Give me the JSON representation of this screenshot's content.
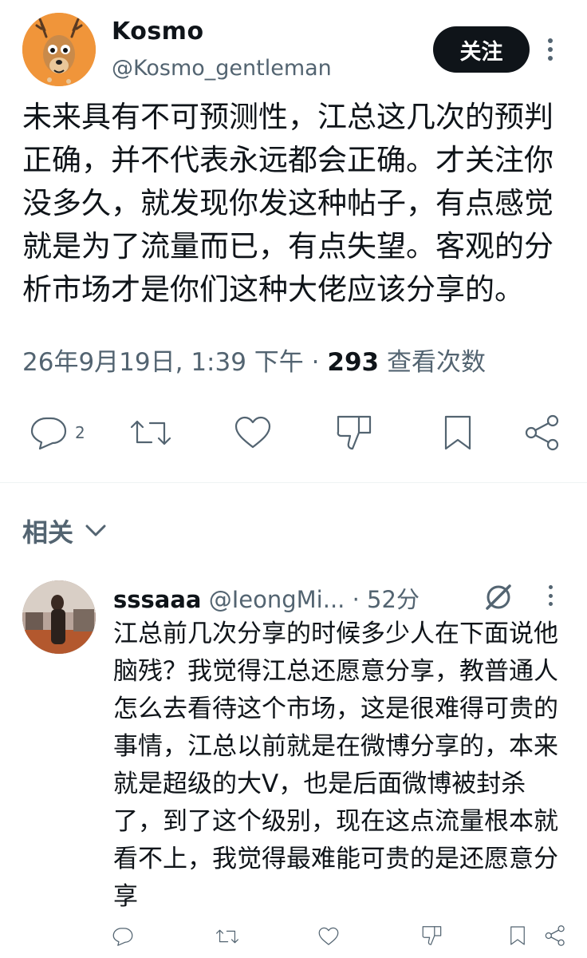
{
  "tweet": {
    "author_name": "Kosmo",
    "author_handle": "@Kosmo_gentleman",
    "follow_label": "关注",
    "text": "未来具有不可预测性，江总这几次的预判正确，并不代表永远都会正确。才关注你没多久，就发现你发这种帖子，有点感觉就是为了流量而已，有点失望。客观的分析市场才是你们这种大佬应该分享的。",
    "date": "26年9月19日, 1:39 下午",
    "dot": "·",
    "views_count": "293",
    "views_label": "查看次数",
    "reply_count": "2"
  },
  "related": {
    "label": "相关"
  },
  "reply": {
    "author_name": "sssaaa",
    "author_handle": "@IeongMi...",
    "time": "· 52分",
    "text": "江总前几次分享的时候多少人在下面说他脑残？我觉得江总还愿意分享，教普通人怎么去看待这个市场，这是很难得可贵的事情，江总以前就是在微博分享的，本来就是超级的大V，也是后面微博被封杀了，到了这个级别，现在这点流量根本就看不上，我觉得最难能可贵的是还愿意分享"
  },
  "icons": {
    "reply": "speech-bubble-icon",
    "retweet": "retweet-icon",
    "like": "heart-icon",
    "dislike": "thumbs-down-icon",
    "bookmark": "bookmark-icon",
    "share": "share-icon",
    "more": "more-vertical-icon",
    "grok": "grok-icon",
    "chevron": "chevron-down-icon"
  },
  "colors": {
    "text": "#0f1419",
    "secondary": "#536471",
    "button_bg": "#0f1419",
    "avatar_bg": "#f0953a"
  }
}
